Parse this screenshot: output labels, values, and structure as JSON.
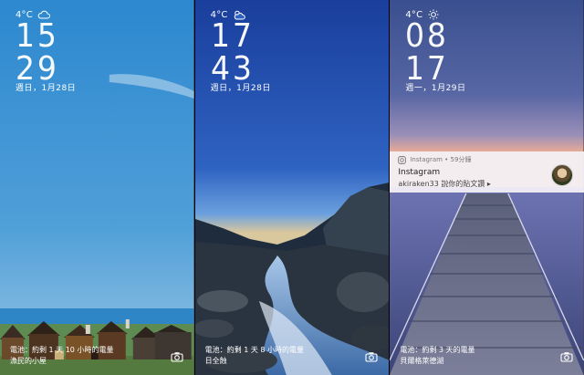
{
  "screens": [
    {
      "weather": "4°C",
      "weather_icon": "cloud-icon",
      "hour": "15",
      "minute": "29",
      "date": "週日，1月28日",
      "battery": "電池：約剩 1 天 10 小時的電量",
      "caption": "漁民的小屋"
    },
    {
      "weather": "4°C",
      "weather_icon": "cloud-sun-icon",
      "hour": "17",
      "minute": "43",
      "date": "週日，1月28日",
      "battery": "電池：約剩 1 天 8 小時的電量",
      "caption": "日全蝕"
    },
    {
      "weather": "4°C",
      "weather_icon": "sun-icon",
      "hour": "08",
      "minute": "17",
      "date": "週一，1月29日",
      "battery": "電池：約剩 3 天的電量",
      "caption": "貝爾格萊德湖",
      "notification": {
        "app": "Instagram • 59分鐘",
        "title": "Instagram",
        "text": "akiraken33 說你的貼文讚 ▸"
      }
    }
  ]
}
